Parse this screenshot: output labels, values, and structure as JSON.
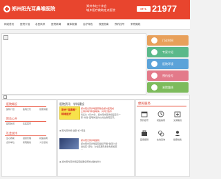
{
  "header": {
    "site_name": "郑州阳光耳鼻喉医院",
    "slogan_line1": "郑州市红十字会",
    "slogan_line2": "城乡医疗救助定点医院",
    "phone_prefix": "0371-",
    "phone_number": "21977"
  },
  "nav": [
    "网站首页",
    "医院介绍",
    "名医风采",
    "医院新闻",
    "媒体报道",
    "治疗特色",
    "就医指南",
    "预约挂号",
    "来院路线"
  ],
  "quick_links": [
    {
      "label": "门诊时间",
      "color": "#e8a05a"
    },
    {
      "label": "专家介绍",
      "color": "#5bb98a"
    },
    {
      "label": "医院环境",
      "color": "#5ba3d9"
    },
    {
      "label": "预约挂号",
      "color": "#e37a8a"
    },
    {
      "label": "来院路线",
      "color": "#7dbb5c"
    }
  ],
  "left_panels": {
    "panel1": {
      "title": "医院概况",
      "links": [
        "医院介绍",
        "医院文化",
        "健康讲座"
      ]
    },
    "panel2": {
      "title": "院务公开",
      "links": [
        "医院新闻",
        "名医荟萃"
      ]
    },
    "panel3": {
      "title": "社会支持",
      "links": [
        "爱心救助",
        "健康管理",
        "就医指南",
        "合作单位",
        "来院路线",
        "义诊活动"
      ]
    }
  },
  "news": {
    "tabs": [
      "医院资讯",
      "学科建设"
    ],
    "thumb1_text": [
      "阳光\"耳鼻喉\"",
      "精准医疗"
    ],
    "item1": [
      "郑州阳光耳鼻喉医院联合郑州医院成",
      "立耳鼻喉专科医联体，共同打造专",
      "科名片 4月28日，郑州阳光耳鼻喉医院与一",
      "家“共建”医联体签约仪式在我院召开。"
    ],
    "bullet1": "◆ 阳光耳鼻喉 健康“好”传递",
    "item2": [
      "郑州阳光耳鼻喉医院",
      "郑州阳光耳鼻喉医院组织开展“健康义诊",
      "进社区”活动，为社区居民提供免费检查",
      "..."
    ],
    "bullet2": "◆ 郑州阳光耳鼻喉医院提醒您预防过敏性鼻炎"
  },
  "services": {
    "title": "便民服务",
    "items": [
      "预约挂号",
      "就医指南",
      "交通路线",
      "医保报销",
      "在线咨询",
      "健康档案"
    ]
  }
}
